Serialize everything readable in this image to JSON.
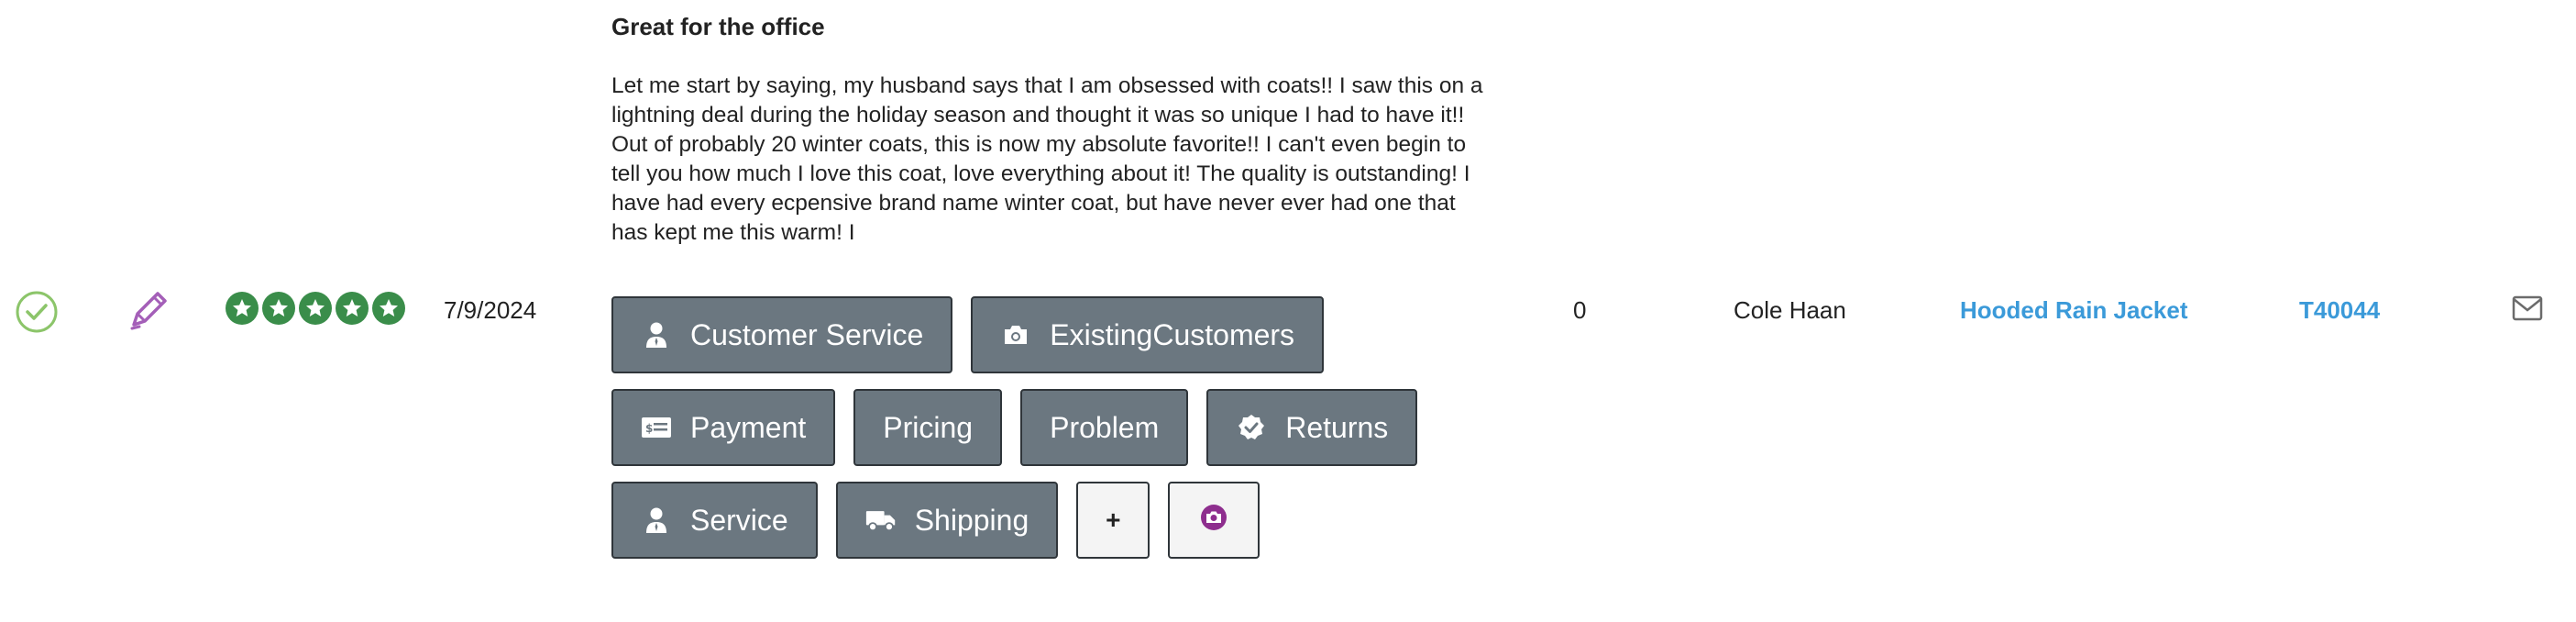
{
  "review": {
    "title": "Great for the office",
    "body": "Let me start by saying, my husband says that I am obsessed with coats!! I saw this on a lightning deal during the holiday season and thought it was so unique I had to have it!! Out of probably 20 winter coats, this is now my absolute favorite!! I can't even begin to tell you how much I love this coat, love everything about it! The quality is outstanding! I have had every ecpensive brand name winter coat, but have never ever had one that has kept me this warm! I",
    "rating": 5,
    "date": "7/9/2024",
    "count": "0",
    "brand": "Cole Haan",
    "product": "Hooded Rain Jacket",
    "sku": "T40044"
  },
  "tags": [
    {
      "label": "Customer Service",
      "icon": "person-icon"
    },
    {
      "label": "ExistingCustomers",
      "icon": "camera-icon"
    },
    {
      "label": "Payment",
      "icon": "payment-card-icon"
    },
    {
      "label": "Pricing",
      "icon": ""
    },
    {
      "label": "Problem",
      "icon": ""
    },
    {
      "label": "Returns",
      "icon": "badge-check-icon"
    },
    {
      "label": "Service",
      "icon": "person-icon"
    },
    {
      "label": "Shipping",
      "icon": "truck-icon"
    }
  ],
  "actions": {
    "add_label": "+"
  },
  "colors": {
    "tag_bg": "#6b7780",
    "link": "#3b9ad9",
    "star": "#3a8d4a",
    "approve": "#8cc56a",
    "edit": "#a45fb8",
    "camera_accent": "#8e2e8e"
  }
}
